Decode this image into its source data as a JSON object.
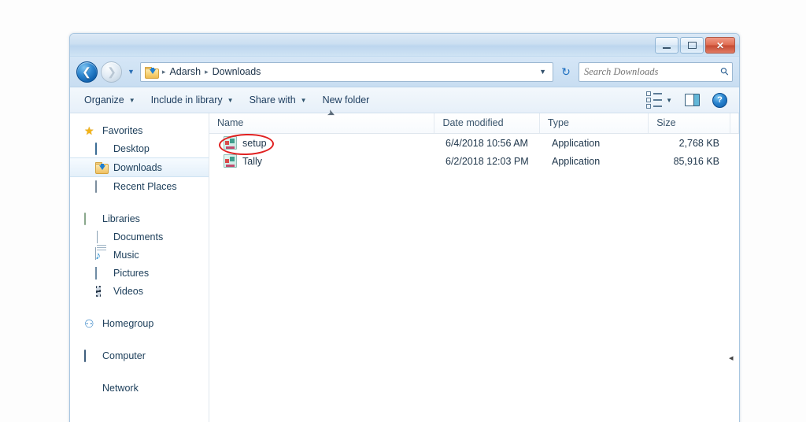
{
  "window": {
    "controls": {
      "minimize_label": "Minimize",
      "maximize_label": "Maximize",
      "close_label": "Close"
    }
  },
  "address": {
    "folder_icon": "downloads-folder-icon",
    "crumbs": [
      "Adarsh",
      "Downloads"
    ],
    "separator": "▸",
    "dropdown_caret": "▼",
    "refresh_icon": "↺"
  },
  "search": {
    "placeholder": "Search Downloads",
    "value": "",
    "icon": "search-icon"
  },
  "toolbar": {
    "items": [
      {
        "label": "Organize",
        "caret": "▼"
      },
      {
        "label": "Include in library",
        "caret": "▼"
      },
      {
        "label": "Share with",
        "caret": "▼"
      },
      {
        "label": "New folder",
        "caret": ""
      }
    ],
    "views_caret": "▼",
    "help_label": "?"
  },
  "sidebar": {
    "groups": [
      {
        "header": {
          "label": "Favorites",
          "icon": "star-icon"
        },
        "items": [
          {
            "label": "Desktop",
            "icon": "desktop-icon",
            "selected": false
          },
          {
            "label": "Downloads",
            "icon": "downloads-folder-icon",
            "selected": true
          },
          {
            "label": "Recent Places",
            "icon": "recent-places-icon",
            "selected": false
          }
        ]
      },
      {
        "header": {
          "label": "Libraries",
          "icon": "library-icon"
        },
        "items": [
          {
            "label": "Documents",
            "icon": "document-icon",
            "selected": false
          },
          {
            "label": "Music",
            "icon": "music-note-icon",
            "selected": false
          },
          {
            "label": "Pictures",
            "icon": "picture-icon",
            "selected": false
          },
          {
            "label": "Videos",
            "icon": "video-icon",
            "selected": false
          }
        ]
      },
      {
        "header": {
          "label": "Homegroup",
          "icon": "homegroup-icon"
        },
        "items": []
      },
      {
        "header": {
          "label": "Computer",
          "icon": "computer-icon"
        },
        "items": []
      },
      {
        "header": {
          "label": "Network",
          "icon": "network-icon"
        },
        "items": []
      }
    ]
  },
  "filelist": {
    "columns": [
      "Name",
      "Date modified",
      "Type",
      "Size"
    ],
    "rows": [
      {
        "name": "setup",
        "date_modified": "6/4/2018 10:56 AM",
        "type": "Application",
        "size": "2,768 KB",
        "icon": "application-icon",
        "annotated": true
      },
      {
        "name": "Tally",
        "date_modified": "6/2/2018 12:03 PM",
        "type": "Application",
        "size": "85,916 KB",
        "icon": "application-icon",
        "annotated": false
      }
    ]
  },
  "annotation": {
    "color": "#e02020",
    "shape": "oval",
    "target": "setup"
  }
}
